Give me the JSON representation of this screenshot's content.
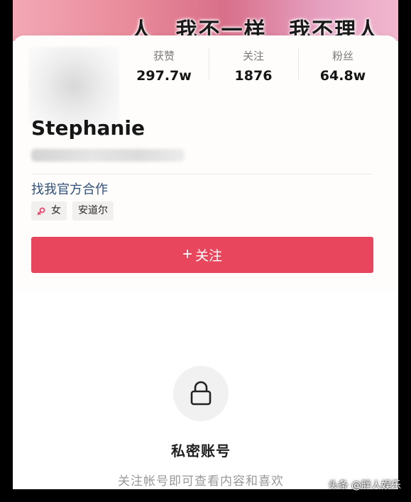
{
  "banner": {
    "left_text": "人",
    "mid_text": "我不一样",
    "right_text": "我不理人"
  },
  "stats": [
    {
      "label": "获赞",
      "value": "297.7w"
    },
    {
      "label": "关注",
      "value": "1876"
    },
    {
      "label": "粉丝",
      "value": "64.8w"
    }
  ],
  "profile": {
    "username": "Stephanie",
    "cooperation_link": "找我官方合作",
    "tags": {
      "gender": "女",
      "location": "安道尔"
    }
  },
  "follow_button": {
    "label": "关注",
    "icon": "plus-icon"
  },
  "private": {
    "icon": "lock-icon",
    "title": "私密账号",
    "subtitle": "关注帐号即可查看内容和喜欢"
  },
  "watermark": "头条 @胖人娱乐",
  "colors": {
    "accent": "#e8465c",
    "link": "#2f4f7a",
    "female": "#e8466e"
  }
}
